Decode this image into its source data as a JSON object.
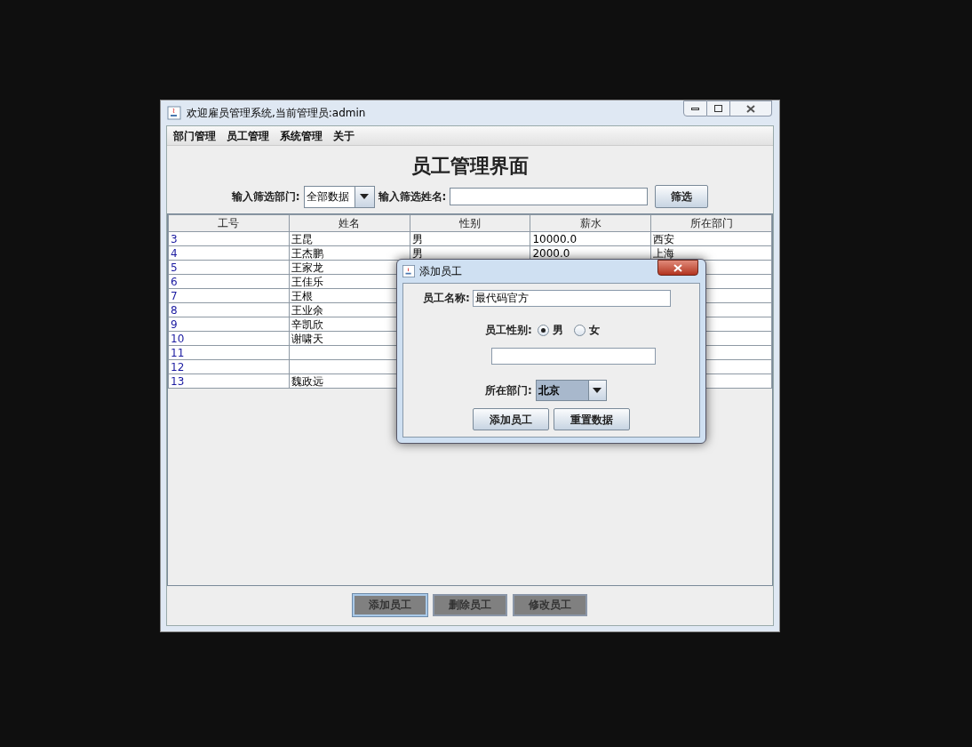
{
  "window": {
    "title": "欢迎雇员管理系统,当前管理员:admin"
  },
  "menu": [
    "部门管理",
    "员工管理",
    "系统管理",
    "关于"
  ],
  "heading": "员工管理界面",
  "filter": {
    "dept_label": "输入筛选部门:",
    "dept_value": "全部数据",
    "name_label": "输入筛选姓名:",
    "button": "筛选"
  },
  "table": {
    "columns": [
      "工号",
      "姓名",
      "性别",
      "薪水",
      "所在部门"
    ],
    "rows": [
      [
        "3",
        "王昆",
        "男",
        "10000.0",
        "西安"
      ],
      [
        "4",
        "王杰鹏",
        "男",
        "2000.0",
        "上海"
      ],
      [
        "5",
        "王家龙"
      ],
      [
        "6",
        "王佳乐"
      ],
      [
        "7",
        "王根"
      ],
      [
        "8",
        "王业余"
      ],
      [
        "9",
        "辛凯欣"
      ],
      [
        "10",
        "谢啸天"
      ],
      [
        "11"
      ],
      [
        "12"
      ],
      [
        "13",
        "魏政远"
      ]
    ]
  },
  "buttons": [
    {
      "label": "添加员工",
      "selected": true
    },
    {
      "label": "删除员工",
      "selected": false
    },
    {
      "label": "修改员工",
      "selected": false
    }
  ],
  "dialog": {
    "title": "添加员工",
    "name_label": "员工名称:",
    "name_value": "最代码官方",
    "gender_label": "员工性别:",
    "genders": [
      {
        "label": "男",
        "selected": true
      },
      {
        "label": "女",
        "selected": false
      }
    ],
    "dept_label": "所在部门:",
    "dept_value": "北京",
    "buttons": [
      "添加员工",
      "重置数据"
    ]
  }
}
